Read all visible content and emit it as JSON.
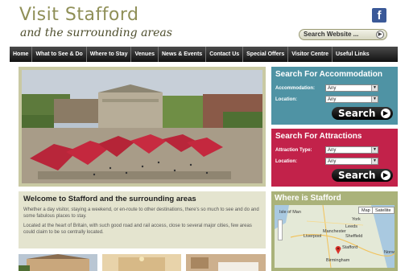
{
  "header": {
    "logo_line1": "Visit Stafford",
    "logo_line2": "and the surrounding areas",
    "search_label": "Search Website ...",
    "facebook_glyph": "f"
  },
  "nav": {
    "items": [
      "Home",
      "What to See & Do",
      "Where to Stay",
      "Venues",
      "News & Events",
      "Contact Us",
      "Special Offers",
      "Visitor Centre",
      "Useful Links"
    ]
  },
  "accommodation": {
    "title": "Search For Accommodation",
    "fields": [
      {
        "label": "Accommodation:",
        "value": "Any"
      },
      {
        "label": "Location:",
        "value": "Any"
      }
    ],
    "button": "Search"
  },
  "attractions": {
    "title": "Search For Attractions",
    "fields": [
      {
        "label": "Attraction Type:",
        "value": "Any"
      },
      {
        "label": "Location:",
        "value": "Any"
      }
    ],
    "button": "Search"
  },
  "welcome": {
    "title": "Welcome to Stafford and the surrounding areas",
    "para1": "Whether a day visitor, staying a weekend, or en-route to other destinations, there's so much to see and do and some fabulous places to stay.",
    "para2": "Located at the heart of Britain, with such good road and rail access, close to several major cities, few areas could claim to be so centrally located."
  },
  "where": {
    "title": "Where is Stafford",
    "map_buttons": [
      "Map",
      "Satellite"
    ],
    "places": [
      "Isle of Man",
      "York",
      "Leeds",
      "Liverpool",
      "Manchester",
      "Sheffield",
      "Stafford",
      "Norw",
      "Birmingham"
    ]
  },
  "colors": {
    "accommodation_bg": "#4f93a4",
    "attractions_bg": "#c2224a",
    "where_bg": "#aab27a",
    "welcome_bg": "#e4e4cf",
    "nav_bg": "#1a1a1a"
  }
}
